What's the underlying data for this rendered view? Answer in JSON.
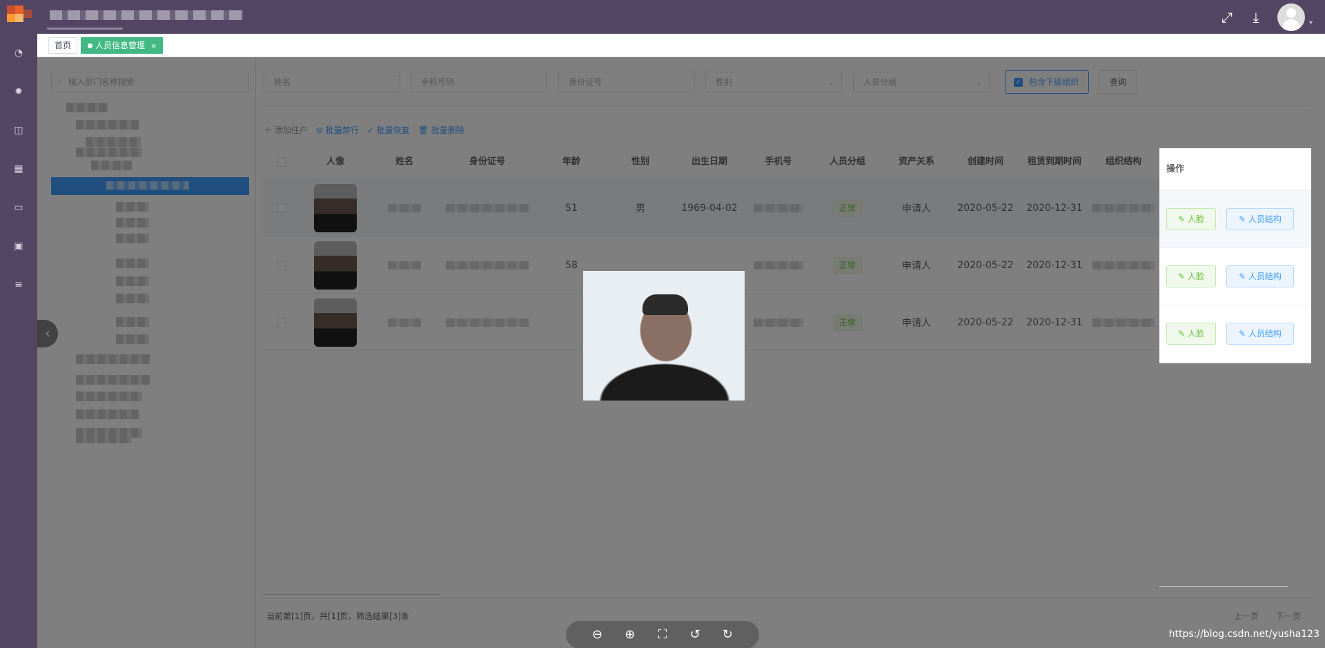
{
  "topbar": {
    "icons": [
      "fullscreen-icon",
      "download-icon"
    ],
    "colors": {
      "bg": "#524664",
      "logo": [
        "#e8632a",
        "#ff9a2e",
        "#c9502a",
        "#f2b66d"
      ]
    }
  },
  "sidebar": {
    "icons": [
      "dashboard-icon",
      "gear-icon",
      "chart-icon",
      "apps-icon",
      "briefcase-icon",
      "monitor-icon",
      "database-icon"
    ]
  },
  "tabs": [
    {
      "label": "首页"
    },
    {
      "label": "人员信息管理",
      "close": "×"
    }
  ],
  "dept": {
    "search_placeholder": "输入部门名称搜索"
  },
  "filters": {
    "name_placeholder": "姓名",
    "phone_placeholder": "手机号码",
    "idcard_placeholder": "身份证号",
    "gender_placeholder": "性别",
    "group_placeholder": "人员分组",
    "include_sub_label": "包含下级组织",
    "query_label": "查询"
  },
  "actions": {
    "add": "添加住户",
    "batch_disable": "批量禁行",
    "batch_restore": "批量恢复",
    "batch_delete": "批量删除"
  },
  "table": {
    "headers": [
      "人像",
      "姓名",
      "身份证号",
      "年龄",
      "性别",
      "出生日期",
      "手机号",
      "人员分组",
      "资产关系",
      "创建时间",
      "租赁到期时间",
      "组织结构",
      "操作"
    ],
    "rows": [
      {
        "age": "51",
        "gender": "男",
        "birth": "1969-04-02",
        "group": "正常",
        "relation": "申请人",
        "created": "2020-05-22",
        "expire": "2020-12-31"
      },
      {
        "age": "58",
        "gender": "",
        "birth": "",
        "group": "正常",
        "relation": "申请人",
        "created": "2020-05-22",
        "expire": "2020-12-31"
      },
      {
        "age": "",
        "gender": "",
        "birth": "",
        "group": "正常",
        "relation": "申请人",
        "created": "2020-05-22",
        "expire": "2020-12-31"
      }
    ],
    "op_face": "人脸",
    "op_struct": "人员结构"
  },
  "pager": {
    "summary": "当前第[1]页，共[1]页，筛选结果[3]条",
    "prev": "上一页",
    "next": "下一页"
  },
  "viewer": {
    "tools": [
      "zoom-out-icon",
      "zoom-in-icon",
      "fit-screen-icon",
      "rotate-left-icon",
      "rotate-right-icon"
    ]
  },
  "watermark": "https://blog.csdn.net/yusha123"
}
